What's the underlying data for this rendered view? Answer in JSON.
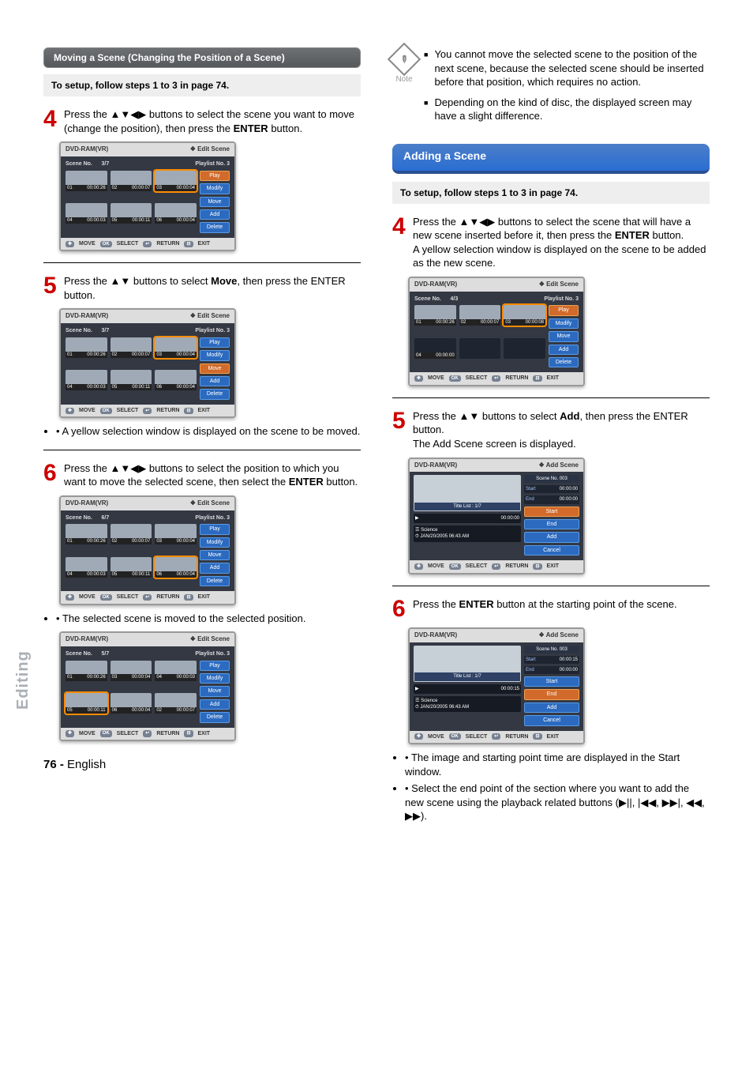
{
  "page": {
    "sideTab": "Editing",
    "footerNum": "76 -",
    "footerLang": "English"
  },
  "left": {
    "header": "Moving a Scene (Changing the Position of a Scene)",
    "setup": "To setup, follow steps 1 to 3 in page 74.",
    "step4": "Press the ▲▼◀▶ buttons to select the scene you want to move (change the position), then press the ENTER button.",
    "step5a": "Press the ▲▼ buttons to select ",
    "step5b": "Move",
    "step5c": ", then press the ENTER button.",
    "bullet5": "A yellow selection window is displayed on the scene to be moved.",
    "step6": "Press the ▲▼◀▶ buttons to select the position to which you want to move the selected scene, then select the ENTER button.",
    "bullet6": "The selected scene is moved to the selected position."
  },
  "right": {
    "noteLabel": "Note",
    "note1": "You cannot move the selected scene to the position of the next scene, because the selected scene should be inserted before that position, which requires no action.",
    "note2": "Depending on the kind of disc, the displayed screen may have a slight difference.",
    "blue": "Adding a Scene",
    "setup": "To setup, follow steps 1 to 3 in page 74.",
    "step4a": "Press the ▲▼◀▶ buttons to select the scene that will have a new scene inserted before it, then press the ENTER button.",
    "step4b": "A yellow selection window is displayed on the scene to be added as the new scene.",
    "step5a": "Press the ▲▼ buttons to select ",
    "step5b": "Add",
    "step5c": ", then press the ENTER button.",
    "step5d": "The Add Scene screen is displayed.",
    "step6a": "Press the ENTER button at the starting point of the scene.",
    "bullet6a": "The image and starting point time are displayed in the Start window.",
    "bullet6b": "Select the end point of the section where you want to add the new scene using the playback related buttons (▶||, |◀◀, ▶▶|, ◀◀, ▶▶)."
  },
  "scr": {
    "title": "DVD-RAM(VR)",
    "mode": "Edit Scene",
    "modeAdd": "Add Scene",
    "sceneNo": "Scene No.",
    "playlist": "Playlist No.  3",
    "sceneNo003": "Scene No. 003",
    "menu": {
      "play": "Play",
      "modify": "Modify",
      "move": "Move",
      "add": "Add",
      "delete": "Delete"
    },
    "addmenu": {
      "start": "Start",
      "end": "End",
      "add": "Add",
      "cancel": "Cancel"
    },
    "foot": {
      "move": "MOVE",
      "select": "SELECT",
      "ret": "RETURN",
      "exit": "EXIT"
    },
    "titleList": "Title List : 1/7",
    "titleName": "Science",
    "titleDate": "JAN/20/2005 06:43 AM",
    "pg_3_7": "3/7",
    "pg_6_7": "6/7",
    "pg_5_7": "5/7",
    "pg_4_3": "4/3",
    "t": {
      "z": "00:00:00",
      "a": "00:00:26",
      "b": "00:00:07",
      "c": "00:00:04",
      "d": "00:00:03",
      "e": "00:00:11",
      "f": "00:00:15",
      "g": "00:00:08"
    },
    "n1": "01",
    "n2": "02",
    "n3": "03",
    "n4": "04",
    "n5": "05",
    "n6": "06",
    "startLbl": "Start",
    "endLbl": "End",
    "playIcon": "▶",
    "clockIcon": "⏱",
    "listIcon": "☰"
  }
}
